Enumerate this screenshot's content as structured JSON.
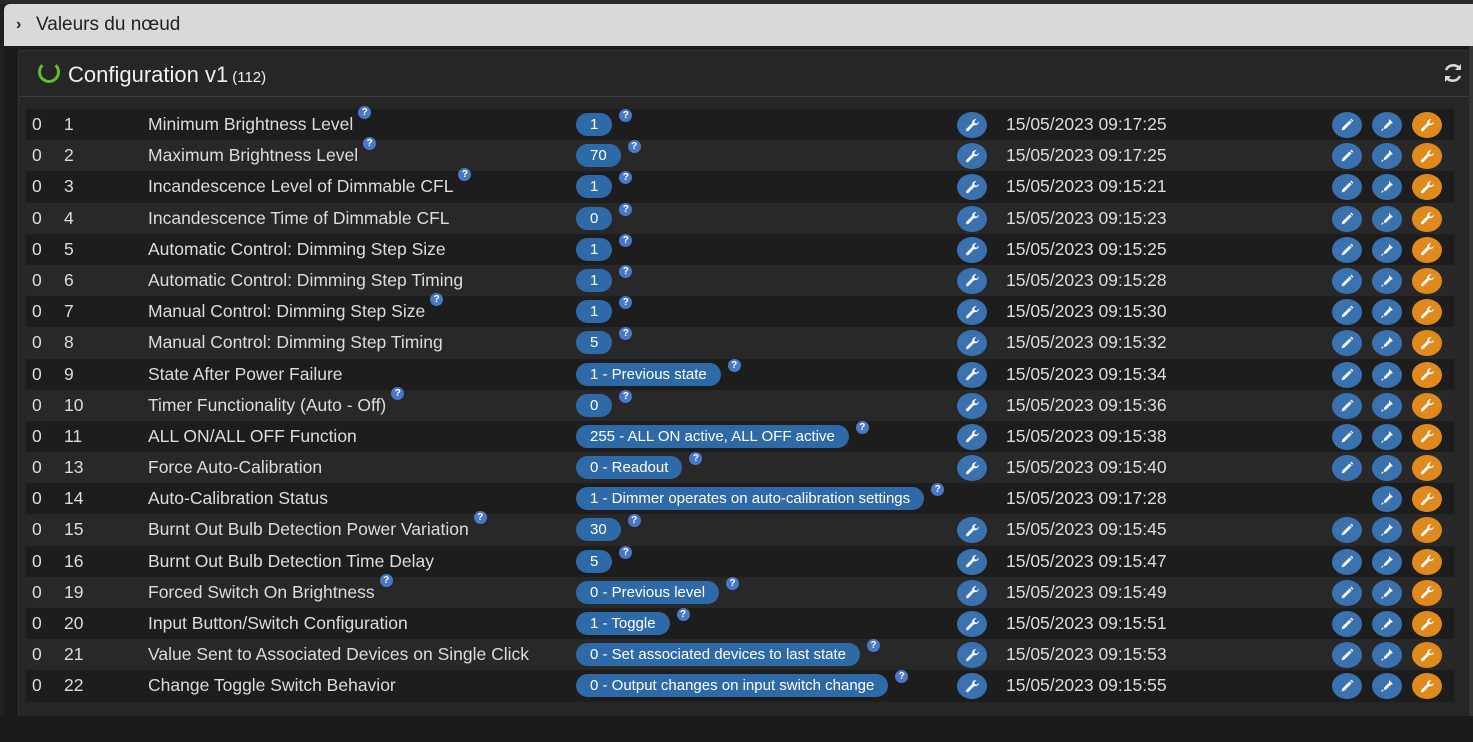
{
  "header": {
    "title": "Valeurs du nœud"
  },
  "panel": {
    "title": "Configuration v1",
    "count": "(112)"
  },
  "rows": [
    {
      "inst": "0",
      "id": "1",
      "name": "Minimum Brightness Level",
      "help": true,
      "value": "1",
      "value_help": true,
      "has_wrench": true,
      "date": "15/05/2023 09:17:25",
      "has_edit": true
    },
    {
      "inst": "0",
      "id": "2",
      "name": "Maximum Brightness Level",
      "help": true,
      "value": "70",
      "value_help": true,
      "has_wrench": true,
      "date": "15/05/2023 09:17:25",
      "has_edit": true
    },
    {
      "inst": "0",
      "id": "3",
      "name": "Incandescence Level of Dimmable CFL",
      "help": true,
      "value": "1",
      "value_help": true,
      "has_wrench": true,
      "date": "15/05/2023 09:15:21",
      "has_edit": true
    },
    {
      "inst": "0",
      "id": "4",
      "name": "Incandescence Time of Dimmable CFL",
      "help": false,
      "value": "0",
      "value_help": true,
      "has_wrench": true,
      "date": "15/05/2023 09:15:23",
      "has_edit": true
    },
    {
      "inst": "0",
      "id": "5",
      "name": "Automatic Control: Dimming Step Size",
      "help": false,
      "value": "1",
      "value_help": true,
      "has_wrench": true,
      "date": "15/05/2023 09:15:25",
      "has_edit": true
    },
    {
      "inst": "0",
      "id": "6",
      "name": "Automatic Control: Dimming Step Timing",
      "help": false,
      "value": "1",
      "value_help": true,
      "has_wrench": true,
      "date": "15/05/2023 09:15:28",
      "has_edit": true
    },
    {
      "inst": "0",
      "id": "7",
      "name": "Manual Control: Dimming Step Size",
      "help": true,
      "value": "1",
      "value_help": true,
      "has_wrench": true,
      "date": "15/05/2023 09:15:30",
      "has_edit": true
    },
    {
      "inst": "0",
      "id": "8",
      "name": "Manual Control: Dimming Step Timing",
      "help": false,
      "value": "5",
      "value_help": true,
      "has_wrench": true,
      "date": "15/05/2023 09:15:32",
      "has_edit": true
    },
    {
      "inst": "0",
      "id": "9",
      "name": "State After Power Failure",
      "help": false,
      "value": "1 - Previous state",
      "value_help": true,
      "has_wrench": true,
      "date": "15/05/2023 09:15:34",
      "has_edit": true
    },
    {
      "inst": "0",
      "id": "10",
      "name": "Timer Functionality (Auto - Off)",
      "help": true,
      "value": "0",
      "value_help": true,
      "has_wrench": true,
      "date": "15/05/2023 09:15:36",
      "has_edit": true
    },
    {
      "inst": "0",
      "id": "11",
      "name": "ALL ON/ALL OFF Function",
      "help": false,
      "value": "255 - ALL ON active, ALL OFF active",
      "value_help": true,
      "has_wrench": true,
      "date": "15/05/2023 09:15:38",
      "has_edit": true
    },
    {
      "inst": "0",
      "id": "13",
      "name": "Force Auto-Calibration",
      "help": false,
      "value": "0 - Readout",
      "value_help": true,
      "has_wrench": true,
      "date": "15/05/2023 09:15:40",
      "has_edit": true
    },
    {
      "inst": "0",
      "id": "14",
      "name": "Auto-Calibration Status",
      "help": false,
      "value": "1 - Dimmer operates on auto-calibration settings",
      "value_help": true,
      "has_wrench": false,
      "date": "15/05/2023 09:17:28",
      "has_edit": false
    },
    {
      "inst": "0",
      "id": "15",
      "name": "Burnt Out Bulb Detection Power Variation",
      "help": true,
      "value": "30",
      "value_help": true,
      "has_wrench": true,
      "date": "15/05/2023 09:15:45",
      "has_edit": true
    },
    {
      "inst": "0",
      "id": "16",
      "name": "Burnt Out Bulb Detection Time Delay",
      "help": false,
      "value": "5",
      "value_help": true,
      "has_wrench": true,
      "date": "15/05/2023 09:15:47",
      "has_edit": true
    },
    {
      "inst": "0",
      "id": "19",
      "name": "Forced Switch On Brightness",
      "help": true,
      "value": "0 - Previous level",
      "value_help": true,
      "has_wrench": true,
      "date": "15/05/2023 09:15:49",
      "has_edit": true
    },
    {
      "inst": "0",
      "id": "20",
      "name": "Input Button/Switch Configuration",
      "help": false,
      "value": "1 - Toggle",
      "value_help": true,
      "has_wrench": true,
      "date": "15/05/2023 09:15:51",
      "has_edit": true
    },
    {
      "inst": "0",
      "id": "21",
      "name": "Value Sent to Associated Devices on Single Click",
      "help": false,
      "value": "0 - Set associated devices to last state",
      "value_help": true,
      "has_wrench": true,
      "date": "15/05/2023 09:15:53",
      "has_edit": true
    },
    {
      "inst": "0",
      "id": "22",
      "name": "Change Toggle Switch Behavior",
      "help": false,
      "value": "0 - Output changes on input switch change",
      "value_help": true,
      "has_wrench": true,
      "date": "15/05/2023 09:15:55",
      "has_edit": true
    }
  ],
  "icons": {
    "expand": "chevron-right-icon",
    "loading": "loading-spinner-icon",
    "refresh": "refresh-icon",
    "help": "question-icon",
    "wrench": "wrench-icon",
    "edit": "pencil-icon",
    "pipette": "pipette-icon",
    "configure": "wrench-icon"
  },
  "colors": {
    "pill": "#2f6aa8",
    "button_blue": "#3a72b0",
    "button_orange": "#e08a1e",
    "spinner": "#5fbf2e",
    "help": "#4a78c8"
  }
}
